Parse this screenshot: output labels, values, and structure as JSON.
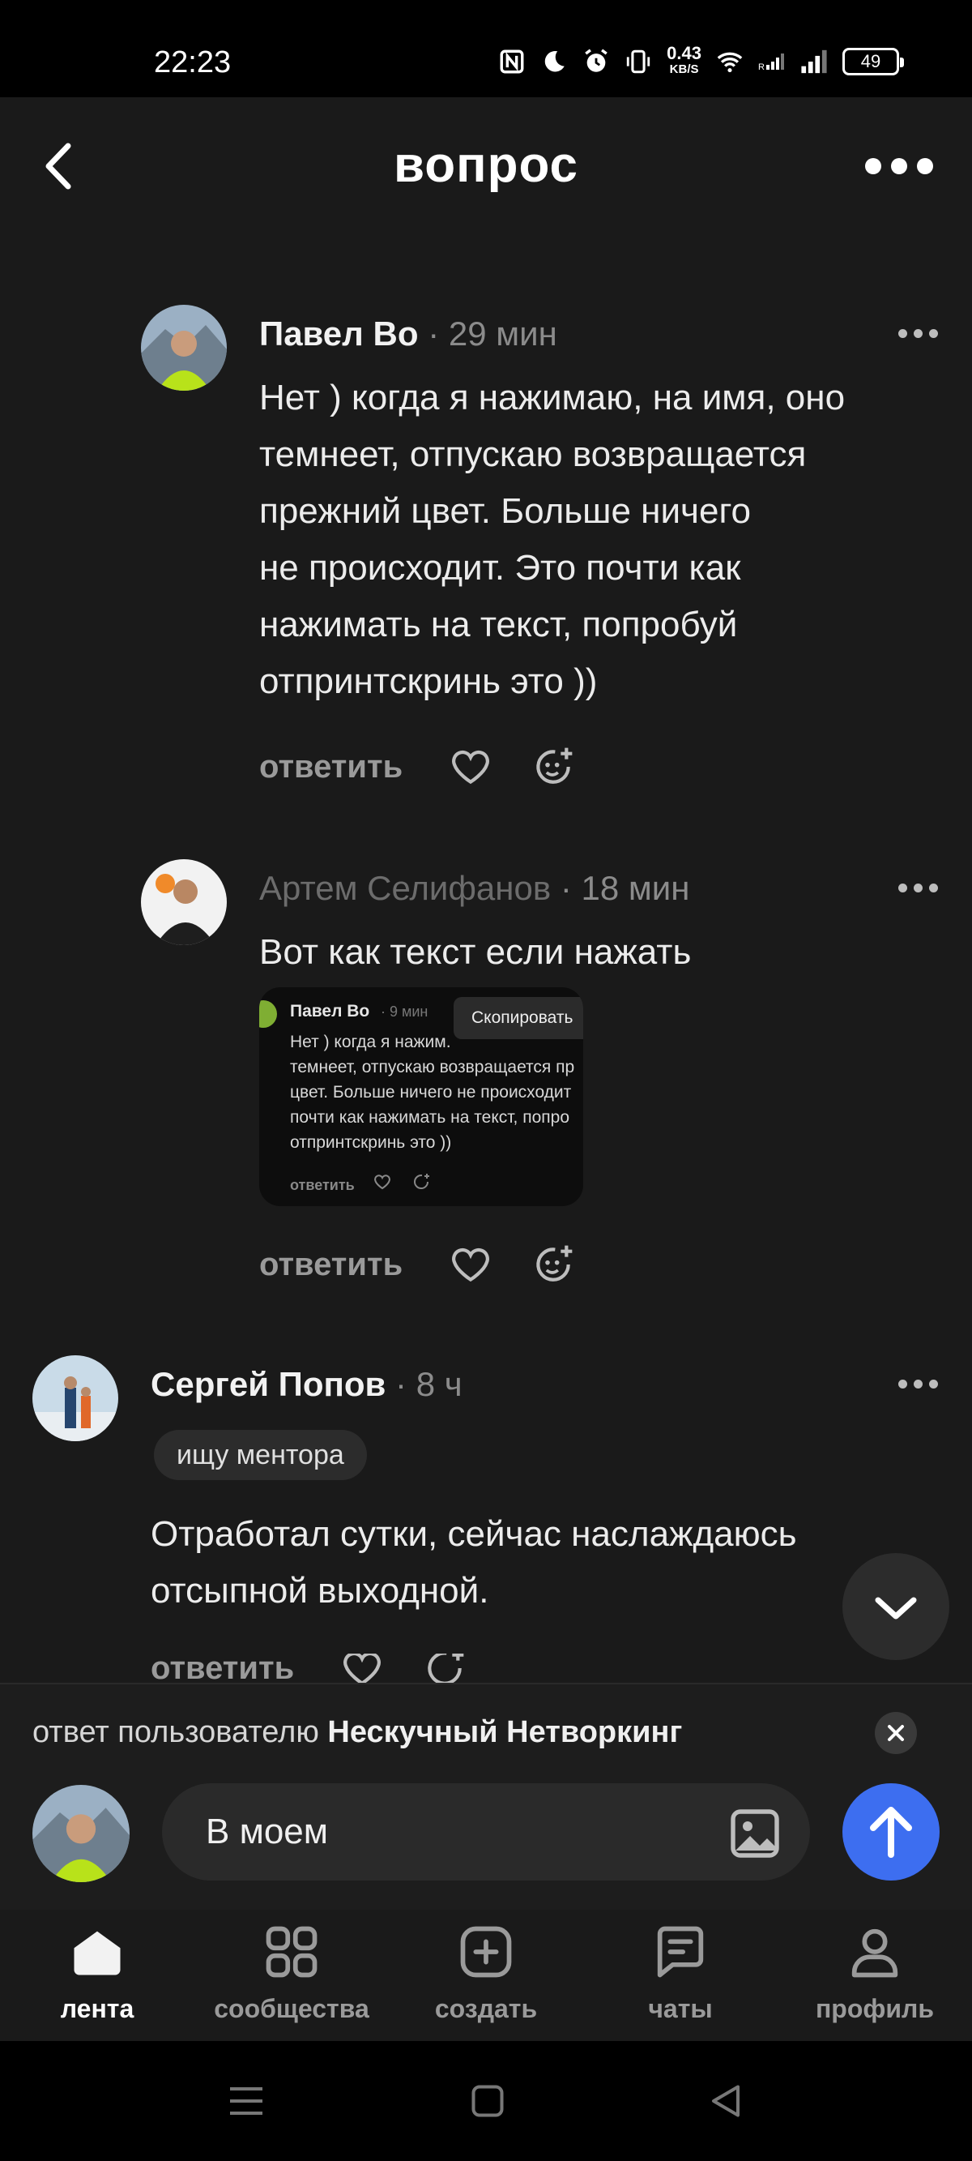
{
  "status_bar": {
    "time": "22:23",
    "speed_value": "0.43",
    "speed_unit": "KB/S",
    "battery": "49"
  },
  "header": {
    "title": "вопрос"
  },
  "comments": [
    {
      "author": "Павел Во",
      "time": "· 29 мин",
      "text_lines": [
        "Нет ) когда я нажимаю, на имя, оно",
        "темнеет, отпускаю возвращается",
        "прежний цвет. Больше ничего",
        "не происходит. Это почти как",
        "нажимать на текст, попробуй",
        "отпринтскринь это ))"
      ],
      "reply_label": "ответить"
    },
    {
      "author": "Артем Селифанов",
      "time": "· 18 мин",
      "text": "Вот как текст если нажать",
      "reply_label": "ответить",
      "embed": {
        "author": "Павел Во",
        "time": "· 9 мин",
        "tooltip": "Скопировать",
        "text_lines": [
          "Нет ) когда я нажим.",
          "темнеет, отпускаю возвращается пр",
          "цвет. Больше ничего не происходит",
          "почти как нажимать на текст, попро",
          "отпринтскринь это ))"
        ],
        "reply_label": "ответить"
      }
    },
    {
      "author": "Сергей Попов",
      "time": "· 8 ч",
      "tag": "ищу ментора",
      "text_lines": [
        "Отработал сутки, сейчас наслаждаюсь",
        "отсыпной выходной."
      ],
      "reply_label": "ответить"
    }
  ],
  "reply_bar": {
    "prefix": "ответ пользователю",
    "recipient": "Нескучный Нетворкинг",
    "input_value": "В моем"
  },
  "tabs": [
    {
      "label": "лента",
      "icon": "home-icon",
      "active": true
    },
    {
      "label": "сообщества",
      "icon": "grid-icon",
      "active": false
    },
    {
      "label": "создать",
      "icon": "plus-square-icon",
      "active": false
    },
    {
      "label": "чаты",
      "icon": "chat-icon",
      "active": false
    },
    {
      "label": "профиль",
      "icon": "person-icon",
      "active": false
    }
  ],
  "colors": {
    "background": "#1a1a1a",
    "accent": "#3d6ef0",
    "muted": "#9a9a9a"
  }
}
